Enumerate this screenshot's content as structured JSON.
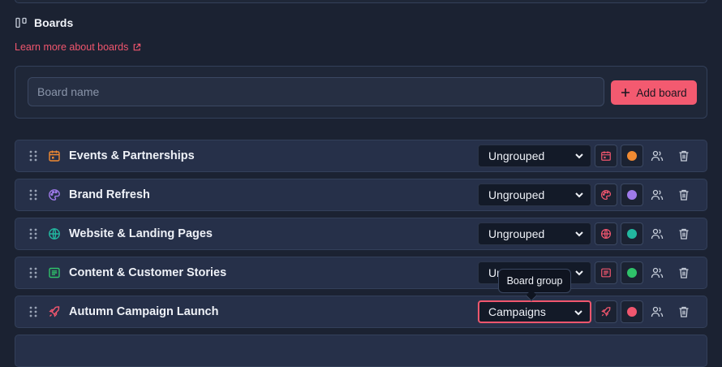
{
  "section": {
    "title": "Boards",
    "learn_more": "Learn more about boards"
  },
  "add_form": {
    "placeholder": "Board name",
    "button_label": "Add board"
  },
  "tooltip": "Board group",
  "boards": [
    {
      "name": "Events & Partnerships",
      "group": "Ungrouped",
      "icon": "calendar-icon",
      "color": "#f08a32"
    },
    {
      "name": "Brand Refresh",
      "group": "Ungrouped",
      "icon": "palette-icon",
      "color": "#9f7aea"
    },
    {
      "name": "Website & Landing Pages",
      "group": "Ungrouped",
      "icon": "globe-icon",
      "color": "#22b8a0"
    },
    {
      "name": "Content & Customer Stories",
      "group": "Ungrouped",
      "icon": "newspaper-icon",
      "color": "#2fc26a"
    },
    {
      "name": "Autumn Campaign Launch",
      "group": "Campaigns",
      "icon": "rocket-icon",
      "color": "#f0566e"
    }
  ]
}
